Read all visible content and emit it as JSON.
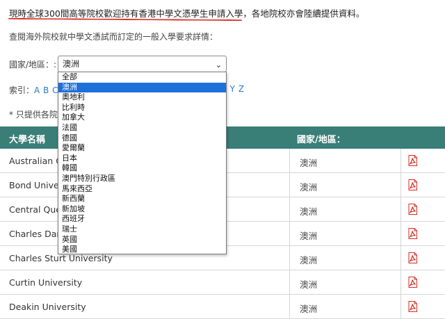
{
  "intro": {
    "text": "現時全球300間高等院校歡迎持有香港中學文憑學生申請入學，各地院校亦會陸續提供資料。"
  },
  "subtitle": "查閱海外院校就中學文憑試而訂定的一般入學要求詳情：",
  "country_filter": {
    "label": "國家/地區：:",
    "selected": "澳洲",
    "options": [
      "全部",
      "澳洲",
      "奧地利",
      "比利時",
      "加拿大",
      "法國",
      "德國",
      "愛爾蘭",
      "日本",
      "韓國",
      "澳門特別行政區",
      "馬來西亞",
      "新西蘭",
      "新加坡",
      "西班牙",
      "瑞士",
      "英國",
      "美國"
    ]
  },
  "index": {
    "label": "索引：",
    "letters_visible": "A B C D",
    "letters_tail": "K Y Z"
  },
  "note": "* 只提供各院",
  "table": {
    "header_name": "大學名稱",
    "header_country": "國家/地區：",
    "rows": [
      {
        "name": "Australian Ca",
        "country": "澳洲"
      },
      {
        "name": "Bond Univers",
        "country": "澳洲"
      },
      {
        "name": "Central Quee",
        "country": "澳洲"
      },
      {
        "name": "Charles Darw",
        "country": "澳洲"
      },
      {
        "name": "Charles Sturt University",
        "country": "澳洲"
      },
      {
        "name": "Curtin University",
        "country": "澳洲"
      },
      {
        "name": "Deakin University",
        "country": "澳洲"
      }
    ]
  },
  "icons": {
    "pdf": "pdf-icon",
    "dropdown_chevron": "chevron-down-icon"
  },
  "colors": {
    "table_header": "#3a7e78",
    "link": "#2b78c5",
    "selection": "#1e6fd9",
    "underline": "#d9342b",
    "pdf_red": "#d12b1f"
  }
}
